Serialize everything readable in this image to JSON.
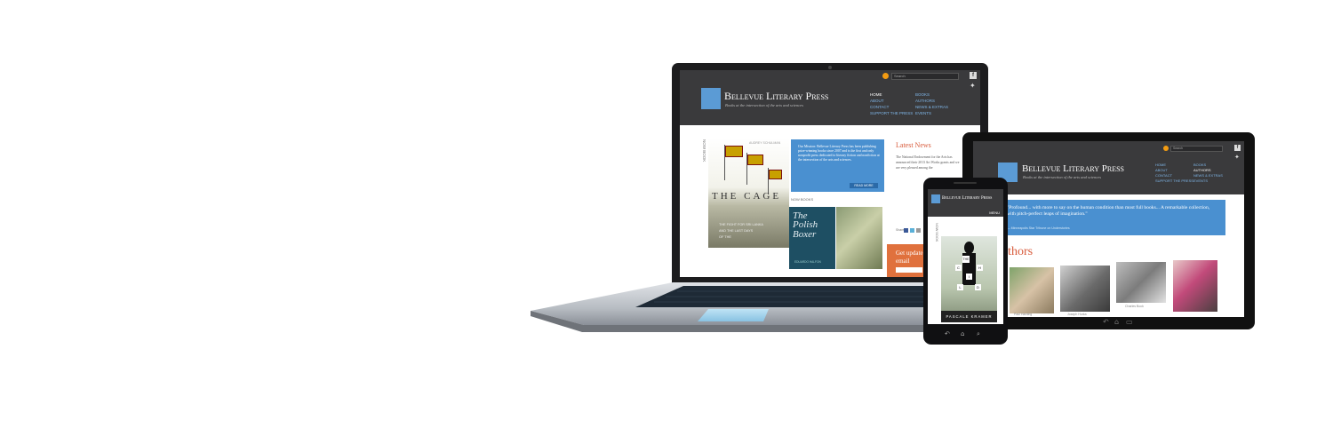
{
  "site": {
    "logo_text": "Bellevue Literary Press",
    "tagline": "Books at the intersection of the arts and sciences",
    "search_placeholder": "Search",
    "nav": [
      "HOME",
      "ABOUT",
      "CONTACT",
      "SUPPORT THE PRESS",
      "BOOKS",
      "AUTHORS",
      "NEWS & EXTRAS",
      "EVENTS"
    ]
  },
  "laptop": {
    "now_label": "NOW BOOK",
    "now_books_label": "NOW BOOKS",
    "cage_author": "AUDREY SCHULMAN",
    "cage_title": "THE CAGE",
    "cage_subtitle_1": "THE FIGHT FOR SRI LANKA",
    "cage_subtitle_2": "AND THE LAST DAYS",
    "cage_subtitle_3": "OF THE",
    "mission_text": "Our Mission: Bellevue Literary Press has been publishing prize-winning books since 2007 and is the first and only nonprofit press dedicated to literary fiction and nonfiction at the intersection of the arts and sciences.",
    "read_more": "READ MORE",
    "polish_title": "The Polish Boxer",
    "polish_author": "EDUARDO HALFON",
    "latest_news": "Latest News",
    "news_text": "The National Endowment for the Arts has announced their 2013 Art Works grants and we are very pleased among the",
    "share_label": "Share",
    "updates_text_1": "Get update",
    "updates_text_2": "email"
  },
  "tablet": {
    "quote_text": "\"Profound... with more to say on the human condition than most full books... A remarkable collection, with pitch-perfect leaps of imagination.\"",
    "quote_source": "— Minneapolis Star Tribune on Understories",
    "authors_heading": "Authors",
    "author_names": [
      "Paul Harding",
      "Joseph Hurka",
      "Charles Bock",
      ""
    ]
  },
  "phone": {
    "menu_label": "MENU",
    "now_label": "NOW BOOK",
    "child_title_letters": [
      "THE",
      "C",
      "H",
      "I",
      "L",
      "D"
    ],
    "child_author": "PASCALE KRAMER"
  },
  "colors": {
    "accent_blue": "#4a90d0",
    "header_dark": "#3a3a3c",
    "news_orange": "#d85a3a"
  }
}
